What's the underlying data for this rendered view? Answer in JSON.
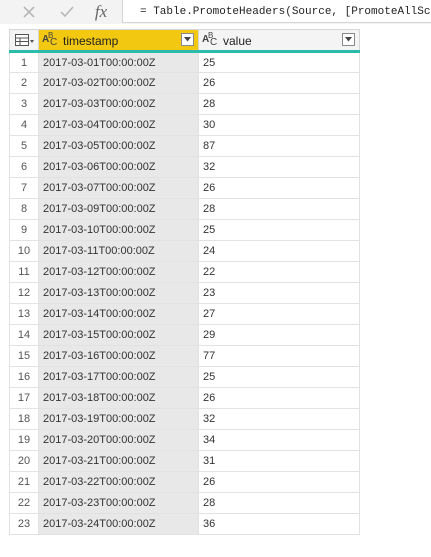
{
  "formula_bar": {
    "cancel_icon": "close-icon",
    "confirm_icon": "check-icon",
    "fx_label": "fx",
    "formula": "= Table.PromoteHeaders(Source, [PromoteAllSc"
  },
  "table": {
    "columns": [
      {
        "name": "timestamp",
        "type_icon": "text-type-icon",
        "selected": true
      },
      {
        "name": "value",
        "type_icon": "text-type-icon",
        "selected": false
      }
    ],
    "colors": {
      "selected_header": "#f2c811",
      "quality_bar": "#2bbbab",
      "selected_column_cells": "#e8e8e8"
    },
    "rows": [
      {
        "num": "1",
        "timestamp": "2017-03-01T00:00:00Z",
        "value": "25"
      },
      {
        "num": "2",
        "timestamp": "2017-03-02T00:00:00Z",
        "value": "26"
      },
      {
        "num": "3",
        "timestamp": "2017-03-03T00:00:00Z",
        "value": "28"
      },
      {
        "num": "4",
        "timestamp": "2017-03-04T00:00:00Z",
        "value": "30"
      },
      {
        "num": "5",
        "timestamp": "2017-03-05T00:00:00Z",
        "value": "87"
      },
      {
        "num": "6",
        "timestamp": "2017-03-06T00:00:00Z",
        "value": "32"
      },
      {
        "num": "7",
        "timestamp": "2017-03-07T00:00:00Z",
        "value": "26"
      },
      {
        "num": "8",
        "timestamp": "2017-03-09T00:00:00Z",
        "value": "28"
      },
      {
        "num": "9",
        "timestamp": "2017-03-10T00:00:00Z",
        "value": "25"
      },
      {
        "num": "10",
        "timestamp": "2017-03-11T00:00:00Z",
        "value": "24"
      },
      {
        "num": "11",
        "timestamp": "2017-03-12T00:00:00Z",
        "value": "22"
      },
      {
        "num": "12",
        "timestamp": "2017-03-13T00:00:00Z",
        "value": "23"
      },
      {
        "num": "13",
        "timestamp": "2017-03-14T00:00:00Z",
        "value": "27"
      },
      {
        "num": "14",
        "timestamp": "2017-03-15T00:00:00Z",
        "value": "29"
      },
      {
        "num": "15",
        "timestamp": "2017-03-16T00:00:00Z",
        "value": "77"
      },
      {
        "num": "16",
        "timestamp": "2017-03-17T00:00:00Z",
        "value": "25"
      },
      {
        "num": "17",
        "timestamp": "2017-03-18T00:00:00Z",
        "value": "26"
      },
      {
        "num": "18",
        "timestamp": "2017-03-19T00:00:00Z",
        "value": "32"
      },
      {
        "num": "19",
        "timestamp": "2017-03-20T00:00:00Z",
        "value": "34"
      },
      {
        "num": "20",
        "timestamp": "2017-03-21T00:00:00Z",
        "value": "31"
      },
      {
        "num": "21",
        "timestamp": "2017-03-22T00:00:00Z",
        "value": "26"
      },
      {
        "num": "22",
        "timestamp": "2017-03-23T00:00:00Z",
        "value": "28"
      },
      {
        "num": "23",
        "timestamp": "2017-03-24T00:00:00Z",
        "value": "36"
      }
    ]
  }
}
